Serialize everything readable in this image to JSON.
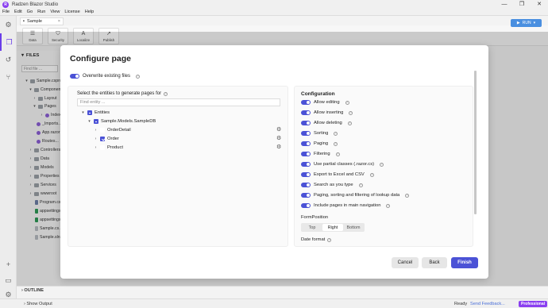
{
  "app": {
    "title": "Radzen Blazor Studio",
    "window_controls": [
      "—",
      "❐",
      "✕"
    ],
    "menu": [
      "File",
      "Edit",
      "Go",
      "Run",
      "View",
      "License",
      "Help"
    ]
  },
  "project_tab": {
    "label": "Sample"
  },
  "ribbon": {
    "buttons": [
      {
        "label": "Data"
      },
      {
        "label": "Security"
      },
      {
        "label": "Localize"
      },
      {
        "label": "Publish"
      }
    ],
    "run_label": "RUN"
  },
  "files": {
    "title": "FILES",
    "find_placeholder": "Find file ...",
    "tree": [
      "Sample.csproj",
      "Components",
      "Layout",
      "Pages",
      "Index...",
      "_Imports...",
      "App.razor",
      "Routes...",
      "Controllers",
      "Data",
      "Models",
      "Properties",
      "Services",
      "wwwroot",
      "Program.cs",
      "appsettings...",
      "appsettings...",
      "Sample.cs...",
      "Sample.sln"
    ]
  },
  "outline": {
    "title": "OUTLINE"
  },
  "status": {
    "show_output": "Show Output",
    "ready": "Ready",
    "feedback": "Send Feedback...",
    "edition": "Professional"
  },
  "dialog": {
    "title": "Configure page",
    "overwrite_label": "Overwrite existing files",
    "entities_label": "Select the entities to generate pages for",
    "entity_find_placeholder": "Find entity ...",
    "entities": {
      "root": "Entities",
      "model": "Sample.Models.SampleDB",
      "items": [
        "OrderDetail",
        "Order",
        "Product"
      ]
    },
    "configuration": {
      "title": "Configuration",
      "options": [
        "Allow editing",
        "Allow inserting",
        "Allow deleting",
        "Sorting",
        "Paging",
        "Filtering",
        "Use partial classes (.razor.cs)",
        "Export to Excel and CSV",
        "Search as you type",
        "Paging, sorting and filtering of lookup data",
        "Include pages in main navigation"
      ],
      "form_position_label": "FormPosition",
      "form_positions": [
        "Top",
        "Right",
        "Bottom"
      ],
      "form_position_selected": "Right",
      "date_format_label": "Date format"
    },
    "buttons": {
      "cancel": "Cancel",
      "back": "Back",
      "finish": "Finish"
    }
  },
  "colors": {
    "accent": "#4b52d6",
    "brand": "#8a3ff0",
    "run": "#4a8fe0"
  }
}
